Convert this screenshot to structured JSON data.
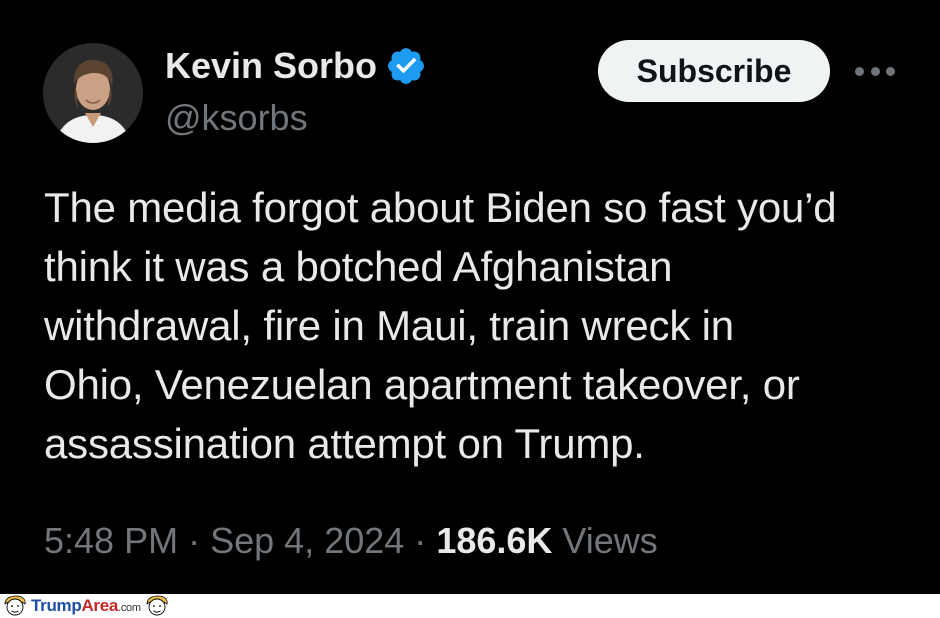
{
  "author": {
    "display_name": "Kevin Sorbo",
    "handle": "@ksorbs",
    "verified": true,
    "avatar_icon": "profile-photo"
  },
  "actions": {
    "subscribe_label": "Subscribe",
    "more_icon": "more-horizontal-icon"
  },
  "tweet": {
    "lines": [
      "The media forgot about Biden so fast you’d",
      "think it was a botched Afghanistan",
      "withdrawal, fire in Maui, train wreck in",
      "Ohio, Venezuelan apartment takeover, or",
      "assassination attempt on Trump."
    ]
  },
  "meta": {
    "time": "5:48 PM",
    "separator": "·",
    "date": "Sep 4, 2024",
    "views_count": "186.6K",
    "views_label": "Views"
  },
  "watermark": {
    "brand_part1": "Trump",
    "brand_part2": "Area",
    "domain": ".com"
  },
  "colors": {
    "background": "#000000",
    "primary_text": "#e7e9ea",
    "secondary_text": "#71767b",
    "verified_blue": "#1d9bf0",
    "button_bg": "#eff3f4"
  }
}
